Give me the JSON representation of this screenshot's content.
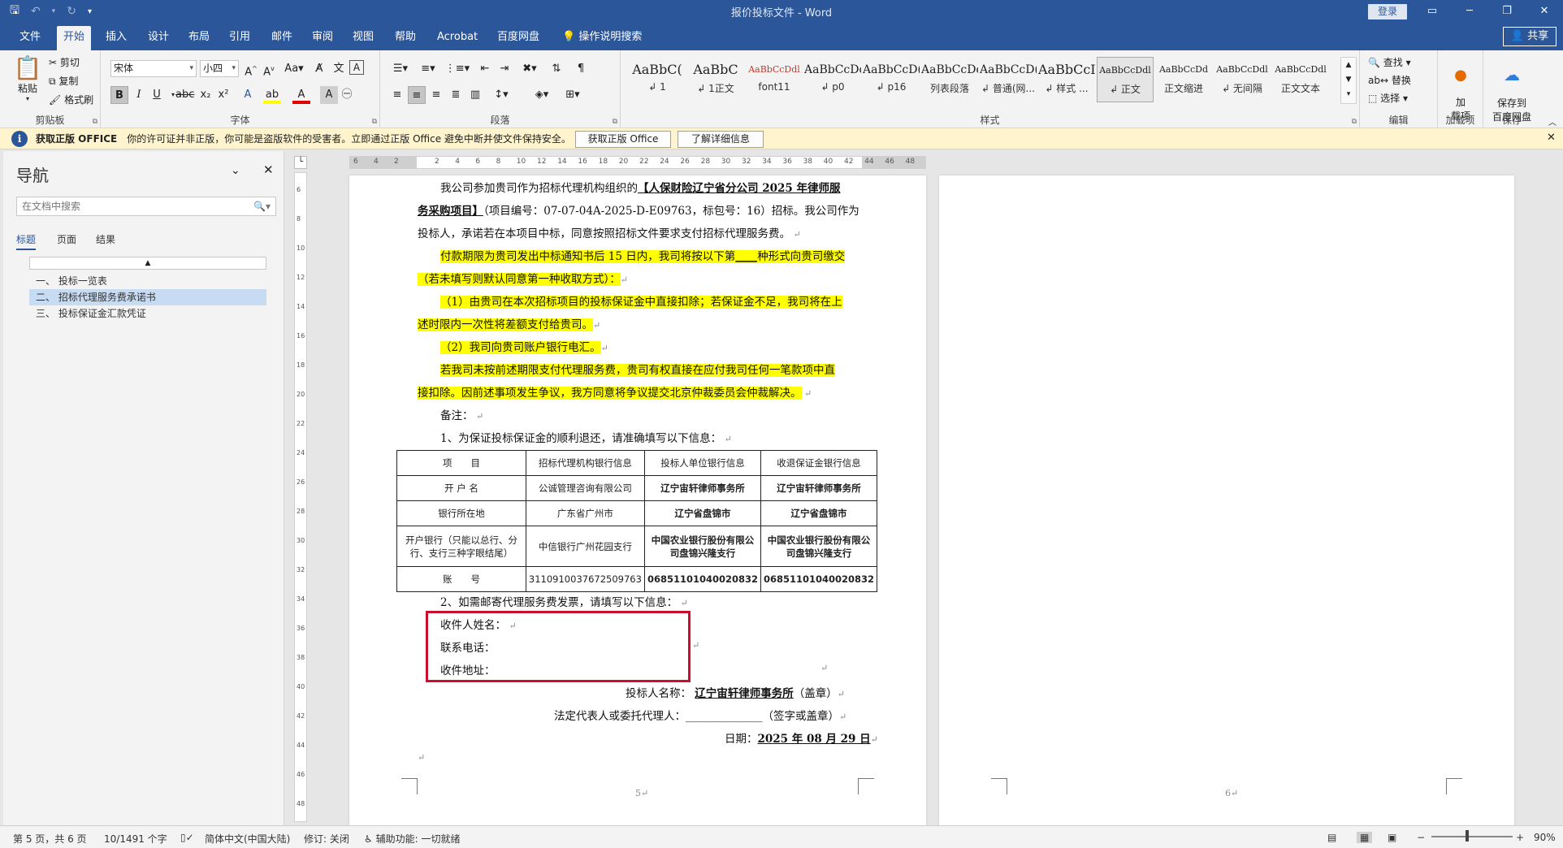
{
  "window": {
    "title": "报价投标文件 - Word",
    "login": "登录",
    "qat_icons": [
      "save-icon",
      "undo-icon",
      "redo-icon",
      "customize-icon"
    ]
  },
  "tabs": [
    "文件",
    "开始",
    "插入",
    "设计",
    "布局",
    "引用",
    "邮件",
    "审阅",
    "视图",
    "帮助",
    "Acrobat",
    "百度网盘",
    "操作说明搜索"
  ],
  "active_tab": "开始",
  "share": "共享",
  "ribbon": {
    "clipboard": {
      "paste": "粘贴",
      "cut": "剪切",
      "copy": "复制",
      "format_painter": "格式刷",
      "label": "剪贴板"
    },
    "font": {
      "name": "宋体",
      "size": "小四",
      "label": "字体"
    },
    "paragraph": {
      "label": "段落"
    },
    "styles": {
      "label": "样式",
      "items": [
        {
          "preview": "AaBbC(",
          "name": "↲ 1"
        },
        {
          "preview": "AaBbC",
          "name": "↲ 1正文"
        },
        {
          "preview": "AaBbCcDdl",
          "name": "font11"
        },
        {
          "preview": "AaBbCcDd",
          "name": "↲ p0"
        },
        {
          "preview": "AaBbCcD(",
          "name": "↲ p16"
        },
        {
          "preview": "AaBbCcDd",
          "name": "列表段落"
        },
        {
          "preview": "AaBbCcD(",
          "name": "↲ 普通(网..."
        },
        {
          "preview": "AaBbCcI",
          "name": "↲ 样式 ..."
        },
        {
          "preview": "AaBbCcDdl",
          "name": "↲ 正文"
        },
        {
          "preview": "AaBbCcDd",
          "name": "正文缩进"
        },
        {
          "preview": "AaBbCcDdl",
          "name": "↲ 无间隔"
        },
        {
          "preview": "AaBbCcDdl",
          "name": "正文文本"
        }
      ]
    },
    "editing": {
      "find": "查找",
      "replace": "替换",
      "select": "选择",
      "label": "编辑"
    },
    "addins": {
      "btn": "加\n载项",
      "label": "加载项"
    },
    "save": {
      "btn": "保存到\n百度网盘",
      "label": "保存"
    }
  },
  "message_bar": {
    "title": "获取正版 OFFICE",
    "text": "你的许可证并非正版，你可能是盗版软件的受害者。立即通过正版 Office 避免中断并使文件保持安全。",
    "btn1": "获取正版 Office",
    "btn2": "了解详细信息"
  },
  "nav": {
    "title": "导航",
    "search_placeholder": "在文档中搜索",
    "tabs": [
      "标题",
      "页面",
      "结果"
    ],
    "items": [
      "一、 投标一览表",
      "二、 招标代理服务费承诺书",
      "三、 投标保证金汇款凭证"
    ]
  },
  "ruler": {
    "h_left": [
      "6",
      "4",
      "2"
    ],
    "h_right": [
      "2",
      "4",
      "6",
      "8",
      "10",
      "12",
      "14",
      "16",
      "18",
      "20",
      "22",
      "24",
      "26",
      "28",
      "30",
      "32",
      "34",
      "36",
      "38",
      "40",
      "42",
      "44",
      "46",
      "48"
    ],
    "v": [
      "6",
      "8",
      "10",
      "12",
      "14",
      "16",
      "18",
      "20",
      "22",
      "24",
      "26",
      "28",
      "30",
      "32",
      "34",
      "36",
      "38",
      "40",
      "42",
      "44",
      "46",
      "48"
    ]
  },
  "doc": {
    "p1a": "我公司参加贵司作为招标代理机构组织的",
    "p1b": "【人保财险辽宁省分公司 2025 年律师服",
    "p1c": "务采购项目】",
    "p1d": "（项目编号：07-07-04A-2025-D-E09763，标包号：16）招标。我公司作为",
    "p1e": "投标人，承诺若在本项目中标，同意按照招标文件要求支付招标代理服务费。",
    "p2a": "付款期限为贵司发出中标通知书后 15 日内，我司将按以下第",
    "p2b": "____",
    "p2c": "种形式向贵司缴交",
    "p2d": "（若未填写则默认同意第一种收取方式）：",
    "p3a": "（1）由贵司在本次招标项目的投标保证金中直接扣除；若保证金不足，我司将在上",
    "p3b": "述时限内一次性将差额支付给贵司。",
    "p4": "（2）我司向贵司账户银行电汇。",
    "p5a": "若我司未按前述期限支付代理服务费，贵司有权直接在应付我司任何一笔款项中直",
    "p5b": "接扣除。因前述事项发生争议，我方同意将争议提交北京仲裁委员会仲裁解决。",
    "note": "备注：",
    "note1": "1、为保证投标保证金的顺利退还，请准确填写以下信息：",
    "note2": "2、如需邮寄代理服务费发票，请填写以下信息：",
    "recipient": "收件人姓名：",
    "phone": "联系电话：",
    "address": "收件地址：",
    "bidder_label": "投标人名称：",
    "bidder_name": "辽宁宙轩律师事务所",
    "bidder_seal": "（盖章）",
    "rep_label": "法定代表人或委托代理人：",
    "rep_blank": "______________",
    "rep_sign": "（签字或盖章）",
    "date_label": "日期：",
    "date_value": "2025 年 08 月 29 日",
    "page_no_5": "5",
    "page_no_6": "6"
  },
  "table": {
    "rows": [
      [
        "项　　目",
        "招标代理机构银行信息",
        "投标人单位银行信息",
        "收退保证金银行信息"
      ],
      [
        "开 户 名",
        "公诚管理咨询有限公司",
        "辽宁宙轩律师事务所",
        "辽宁宙轩律师事务所"
      ],
      [
        "银行所在地",
        "广东省广州市",
        "辽宁省盘锦市",
        "辽宁省盘锦市"
      ],
      [
        "开户银行（只能以总行、分行、支行三种字眼结尾）",
        "中信银行广州花园支行",
        "中国农业银行股份有限公司盘锦兴隆支行",
        "中国农业银行股份有限公司盘锦兴隆支行"
      ],
      [
        "账　　号",
        "3110910037672509763",
        "06851101040020832",
        "06851101040020832"
      ]
    ]
  },
  "status": {
    "page": "第 5 页，共 6 页",
    "words": "10/1491 个字",
    "lang": "简体中文(中国大陆)",
    "track": "修订: 关闭",
    "access": "辅助功能: 一切就绪",
    "zoom": "90%"
  },
  "colors": {
    "brand": "#2b579a",
    "highlight": "#ffff00",
    "red_box": "#c8102e",
    "message_bar": "#fff4ce"
  }
}
